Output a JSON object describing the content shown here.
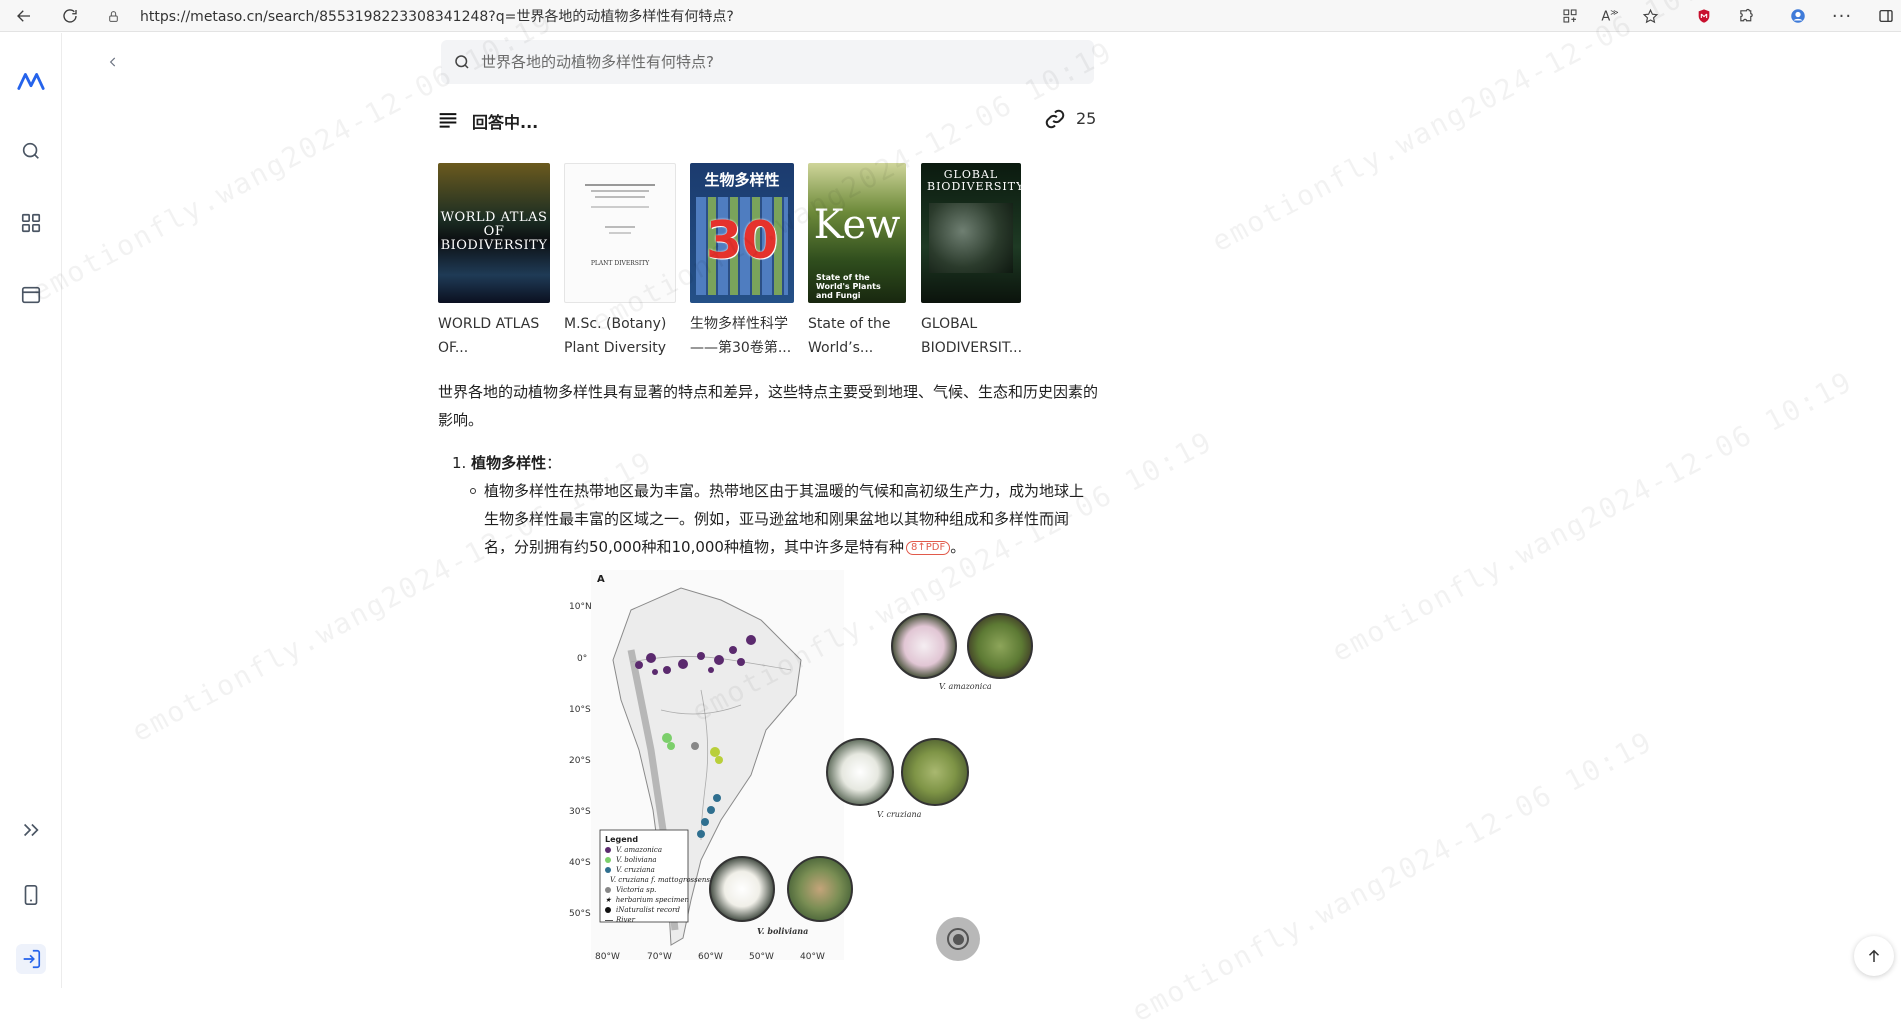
{
  "browser": {
    "url": "https://metaso.cn/search/8553198223308341248?q=世界各地的动植物多样性有何特点?"
  },
  "search": {
    "placeholder": "世界各地的动植物多样性有何特点?"
  },
  "answer": {
    "status": "回答中...",
    "source_count": "25"
  },
  "sources": [
    {
      "title": "WORLD ATLAS OF...",
      "cover_text": "WORLD ATLAS OF BIODIVERSITY"
    },
    {
      "title": "M.Sc. (Botany) Plant Diversity",
      "cover_text": "PLANT DIVERSITY"
    },
    {
      "title": "生物多样性科学——第30卷第...",
      "cover_text": "30",
      "cover_header": "生物多样性"
    },
    {
      "title": "State of the World’s...",
      "cover_text": "Kew",
      "cover_sub": "State of the World's Plants and Fungi"
    },
    {
      "title": "GLOBAL BIODIVERSIT...",
      "cover_text": "GLOBAL BIODIVERSITY"
    }
  ],
  "content": {
    "intro": "世界各地的动植物多样性具有显著的特点和差异，这些特点主要受到地理、气候、生态和历史因素的影响。",
    "section1_number": "1.",
    "section1_title": "植物多样性",
    "section1_colon": "：",
    "section1_bullet": "植物多样性在热带地区最为丰富。热带地区由于其温暖的气候和高初级生产力，成为地球上生物多样性最丰富的区域之一。例如，亚马逊盆地和刚果盆地以其物种组成和多样性而闻名，分别拥有约50,000种和10,000种植物，其中许多是特有种",
    "section1_end": "。",
    "citation": "8↑PDF"
  },
  "figure": {
    "panel_label": "A",
    "lat_labels": [
      "10°N",
      "0°",
      "10°S",
      "20°S",
      "30°S",
      "40°S",
      "50°S"
    ],
    "lon_labels": [
      "80°W",
      "70°W",
      "60°W",
      "50°W",
      "40°W"
    ],
    "legend_title": "Legend",
    "legend_items": [
      {
        "label": "V. amazonica",
        "color": "#5b2a6e"
      },
      {
        "label": "V. boliviana",
        "color": "#7ccf6b"
      },
      {
        "label": "V. cruziana",
        "color": "#2f6f8f"
      },
      {
        "label": "V. cruziana f. mattogrossensis",
        "color": "#b9cf3a"
      },
      {
        "label": "Victoria sp.",
        "color": "#888888"
      },
      {
        "label": "herbarium specimen",
        "color": "#111111"
      },
      {
        "label": "iNaturalist record",
        "color": "#111111"
      },
      {
        "label": "River",
        "color": "#555555"
      }
    ],
    "species": [
      "V. amazonica",
      "V. cruziana",
      "V. boliviana"
    ]
  },
  "watermark": "emotionfly.wang2024-12-06 10:19"
}
